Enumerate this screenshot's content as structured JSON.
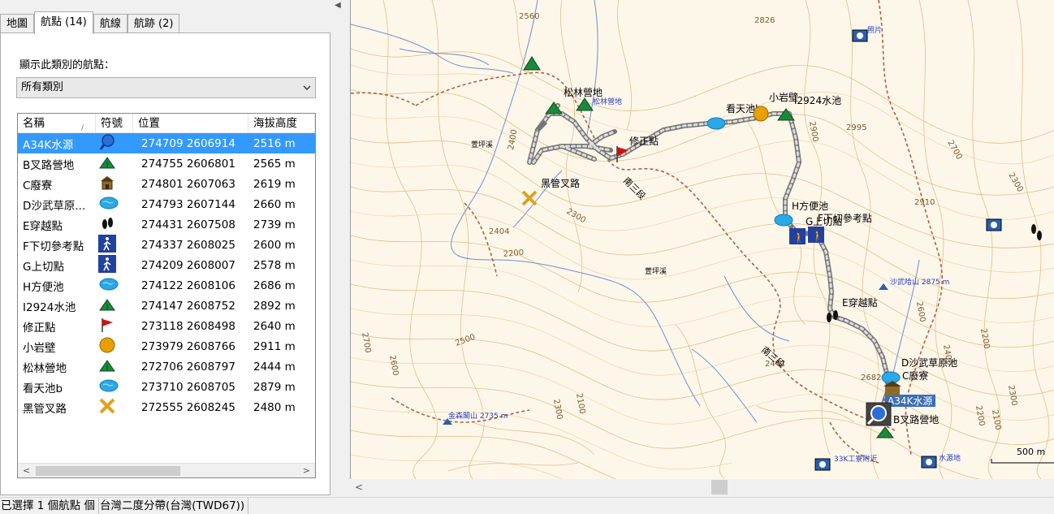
{
  "tabs": [
    {
      "label": "地圖"
    },
    {
      "label": "航點 (14)"
    },
    {
      "label": "航線"
    },
    {
      "label": "航跡 (2)"
    }
  ],
  "category": {
    "label": "顯示此類別的航點：",
    "selected": "所有類別"
  },
  "table": {
    "headers": {
      "name": "名稱",
      "symbol": "符號",
      "position": "位置",
      "altitude": "海拔高度"
    },
    "rows": [
      {
        "name": "A34K水源",
        "icon": "pin-icon",
        "position": "274709 2606914",
        "altitude": "2516 m"
      },
      {
        "name": "B叉路營地",
        "icon": "tent-icon",
        "position": "274755 2606801",
        "altitude": "2565 m"
      },
      {
        "name": "C廢寮",
        "icon": "hut-icon",
        "position": "274801 2607063",
        "altitude": "2619 m"
      },
      {
        "name": "D沙武草原...",
        "icon": "pond-icon",
        "position": "274793 2607144",
        "altitude": "2660 m"
      },
      {
        "name": "E穿越點",
        "icon": "footprint-icon",
        "position": "274431 2607508",
        "altitude": "2739 m"
      },
      {
        "name": "F下切參考點",
        "icon": "hiker-icon",
        "position": "274337 2608025",
        "altitude": "2600 m"
      },
      {
        "name": "G上切點",
        "icon": "hiker-icon",
        "position": "274209 2608007",
        "altitude": "2578 m"
      },
      {
        "name": "H方便池",
        "icon": "pond-icon",
        "position": "274122 2608106",
        "altitude": "2686 m"
      },
      {
        "name": "I2924水池",
        "icon": "tent-icon",
        "position": "274147 2608752",
        "altitude": "2892 m"
      },
      {
        "name": "修正點",
        "icon": "flag-icon",
        "position": "273118 2608498",
        "altitude": "2640 m"
      },
      {
        "name": "小岩壁",
        "icon": "circle-icon",
        "position": "273979 2608766",
        "altitude": "2911 m"
      },
      {
        "name": "松林營地",
        "icon": "tent-icon",
        "position": "272706 2608797",
        "altitude": "2444 m"
      },
      {
        "name": "看天池b",
        "icon": "pond-icon",
        "position": "273710 2608705",
        "altitude": "2879 m"
      },
      {
        "name": "黑管叉路",
        "icon": "cross-icon",
        "position": "272555 2608245",
        "altitude": "2480 m"
      }
    ]
  },
  "map": {
    "labels": [
      {
        "id": "songlin",
        "text": "松林營地"
      },
      {
        "id": "songlin-blue",
        "text": "松林營地"
      },
      {
        "id": "fix",
        "text": "修正點"
      },
      {
        "id": "heiguan",
        "text": "黑管叉路"
      },
      {
        "id": "kantian",
        "text": "看天池b"
      },
      {
        "id": "xiaoyan",
        "text": "小岩壁"
      },
      {
        "id": "i2924",
        "text": "I2924水池"
      },
      {
        "id": "hpond",
        "text": "H方便池"
      },
      {
        "id": "gcut",
        "text": "G上切點"
      },
      {
        "id": "fcut",
        "text": "F下切參考點"
      },
      {
        "id": "ecross",
        "text": "E穿越點"
      },
      {
        "id": "dpond",
        "text": "D沙武草原池"
      },
      {
        "id": "chut",
        "text": "C廢寮"
      },
      {
        "id": "awater",
        "text": "A34K水源"
      },
      {
        "id": "bcamp",
        "text": "B叉路營地"
      },
      {
        "id": "nansan1",
        "text": "南三段"
      },
      {
        "id": "nansan2",
        "text": "南三段"
      },
      {
        "id": "river1",
        "text": "萱坪溪"
      },
      {
        "id": "river2",
        "text": "萱坪溪"
      },
      {
        "id": "peak-shawu",
        "text": "沙武哈山 2875 m"
      },
      {
        "id": "peak-jinsen",
        "text": "金森閣山 2735 m"
      },
      {
        "id": "station",
        "text": "33K工寮附近"
      },
      {
        "id": "water",
        "text": "水源地"
      },
      {
        "id": "photo1",
        "text": "照片"
      },
      {
        "id": "scale",
        "text": "500 m"
      }
    ],
    "contours": [
      "2560",
      "2826",
      "2400",
      "2300",
      "2404",
      "2200",
      "2500",
      "2600",
      "2700",
      "2441",
      "2100",
      "2300",
      "2900",
      "2995",
      "2700",
      "2910",
      "2300",
      "2682",
      "2600",
      "2400",
      "2200",
      "2300",
      "2200",
      "2100"
    ]
  },
  "status": {
    "selected": "已選擇 1 個航點 個",
    "datum": "台灣二度分帶(台灣(TWD67))"
  },
  "colors": {
    "selection": "#3399ff",
    "map_bg": "#fdf7ea",
    "contour": "#e0b070",
    "track": "#8c8c8c",
    "trail": "#b0603a"
  }
}
